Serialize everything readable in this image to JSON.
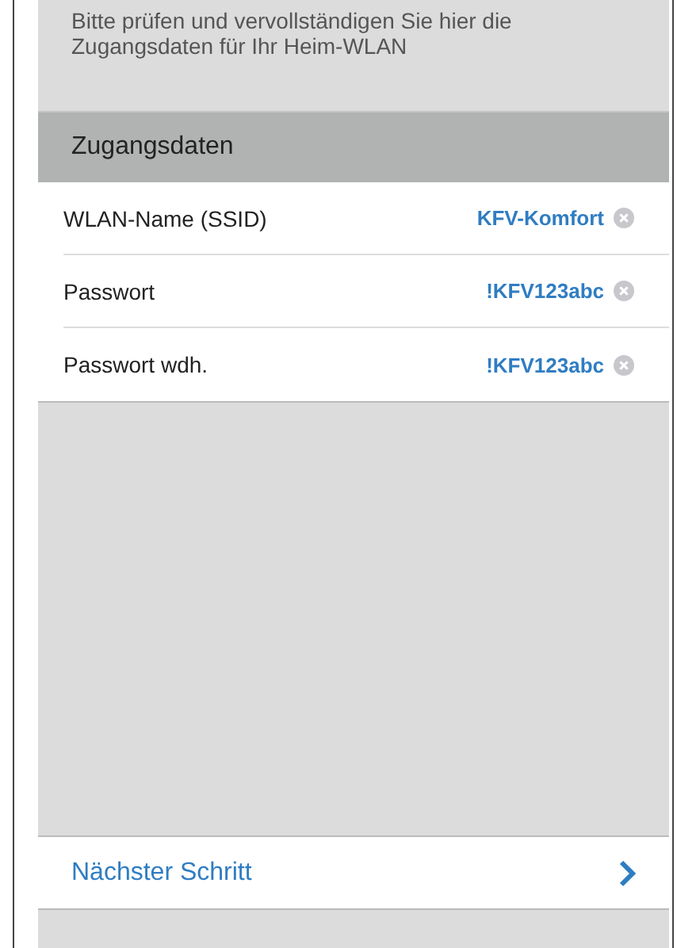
{
  "intro": "Bitte prüfen und vervollständigen Sie hier die Zugangsdaten für Ihr Heim-WLAN",
  "section_header": "Zugangsdaten",
  "fields": [
    {
      "label": "WLAN-Name (SSID)",
      "value": "KFV-Komfort"
    },
    {
      "label": "Passwort",
      "value": "!KFV123abc"
    },
    {
      "label": "Passwort wdh.",
      "value": "!KFV123abc"
    }
  ],
  "next_button": "Nächster Schritt"
}
